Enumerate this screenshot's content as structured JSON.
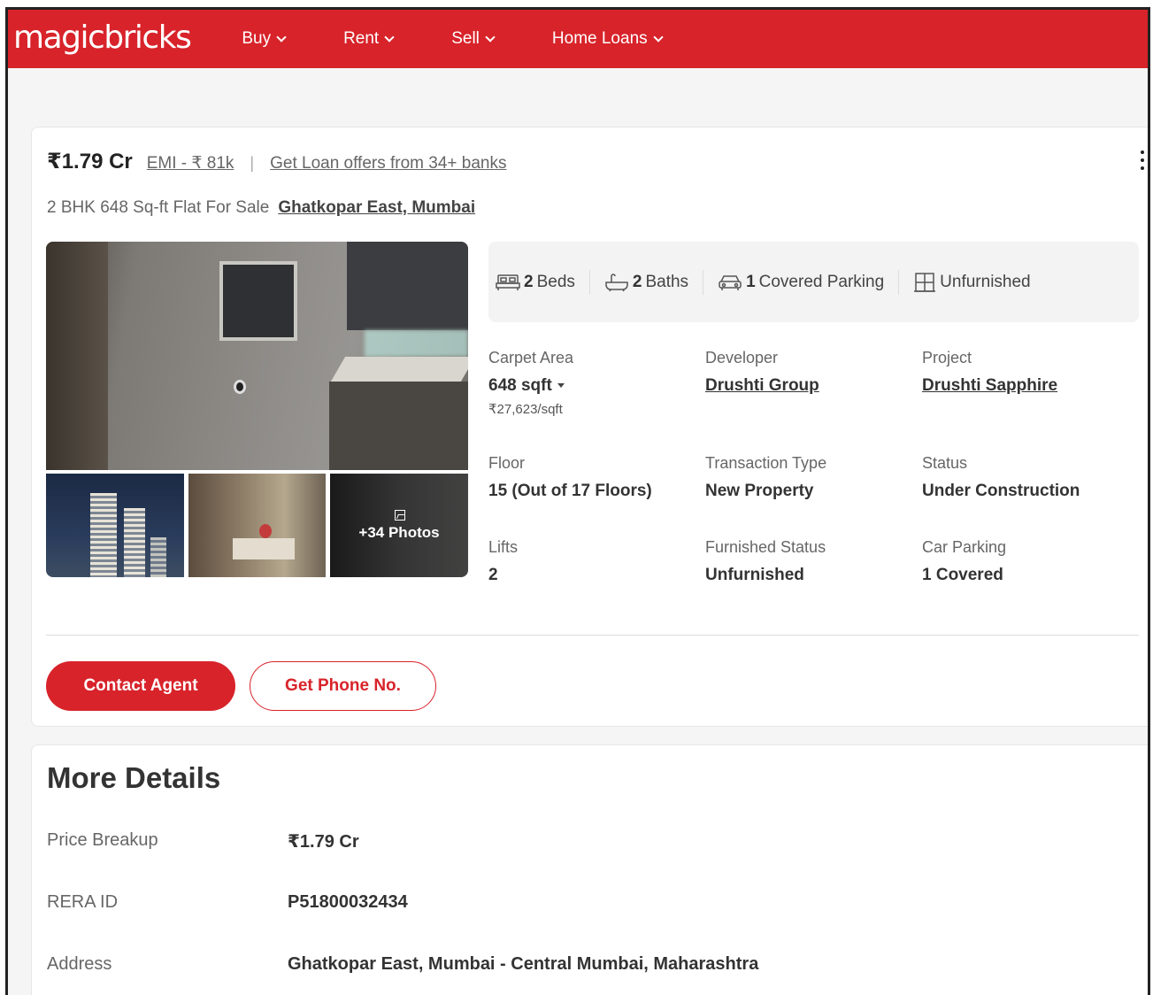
{
  "header": {
    "logo": "magicbricks",
    "brand_color": "#d8232a",
    "nav": [
      {
        "label": "Buy"
      },
      {
        "label": "Rent"
      },
      {
        "label": "Sell"
      },
      {
        "label": "Home Loans"
      }
    ]
  },
  "listing": {
    "price": "₹1.79 Cr",
    "emi": "EMI - ₹ 81k",
    "separator": "|",
    "loan_offer": "Get Loan offers from 34+ banks",
    "title": "2 BHK 648 Sq-ft Flat For Sale",
    "locality": "Ghatkopar East, Mumbai",
    "photos_more": "+34 Photos",
    "summary": [
      {
        "icon": "bed-icon",
        "value": "2",
        "label": "Beds"
      },
      {
        "icon": "bath-icon",
        "value": "2",
        "label": "Baths"
      },
      {
        "icon": "car-icon",
        "value": "1",
        "label": "Covered Parking"
      },
      {
        "icon": "furnishing-icon",
        "value": "",
        "label": "Unfurnished"
      }
    ],
    "attributes": {
      "carpet_area": {
        "label": "Carpet Area",
        "value": "648 sqft",
        "sub": "₹27,623/sqft"
      },
      "developer": {
        "label": "Developer",
        "value": "Drushti Group"
      },
      "project": {
        "label": "Project",
        "value": "Drushti Sapphire"
      },
      "floor": {
        "label": "Floor",
        "value": "15 (Out of 17 Floors)"
      },
      "transaction": {
        "label": "Transaction Type",
        "value": "New Property"
      },
      "status": {
        "label": "Status",
        "value": "Under Construction"
      },
      "lifts": {
        "label": "Lifts",
        "value": "2"
      },
      "furnished": {
        "label": "Furnished Status",
        "value": "Unfurnished"
      },
      "car_parking": {
        "label": "Car Parking",
        "value": "1 Covered"
      }
    },
    "buttons": {
      "contact": "Contact Agent",
      "phone": "Get Phone No."
    }
  },
  "more_details": {
    "title": "More Details",
    "rows": [
      {
        "key": "Price Breakup",
        "value": "₹1.79 Cr"
      },
      {
        "key": "RERA ID",
        "value": "P51800032434"
      },
      {
        "key": "Address",
        "value": "Ghatkopar East, Mumbai - Central Mumbai, Maharashtra"
      }
    ]
  }
}
